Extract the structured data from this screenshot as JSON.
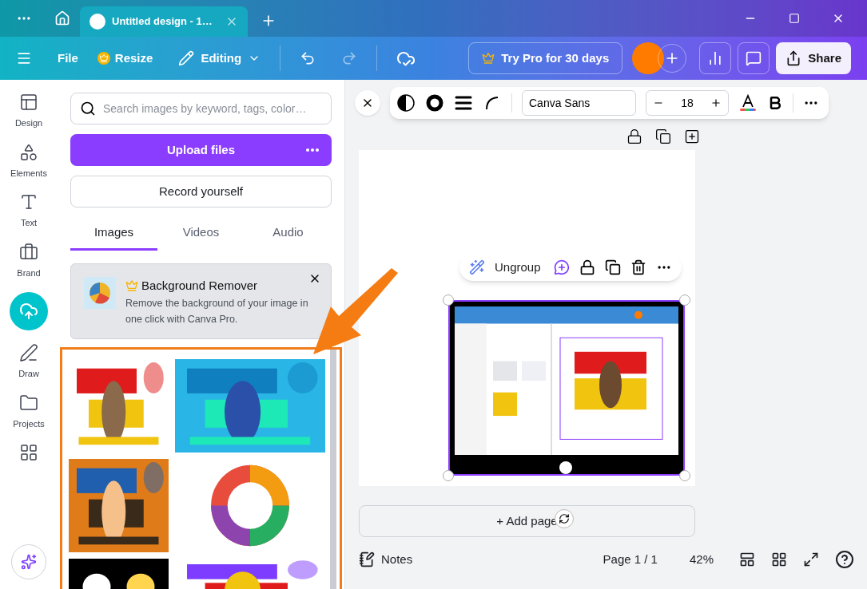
{
  "browser_tabs": [
    {
      "label": "Untitled design - 1…",
      "selected": true
    }
  ],
  "toolbar": {
    "file": "File",
    "resize": "Resize",
    "mode": "Editing",
    "pro": "Try Pro for 30 days",
    "share": "Share"
  },
  "sidebar": {
    "items": [
      {
        "kind": "design",
        "label": "Design",
        "selected": false
      },
      {
        "kind": "elements",
        "label": "Elements",
        "selected": false
      },
      {
        "kind": "text",
        "label": "Text",
        "selected": false
      },
      {
        "kind": "brand",
        "label": "Brand",
        "selected": false
      },
      {
        "kind": "uploads",
        "selected": true
      },
      {
        "kind": "draw",
        "label": "Draw",
        "selected": false
      },
      {
        "kind": "projects",
        "label": "Projects",
        "selected": false
      },
      {
        "kind": "apps",
        "selected": false
      }
    ]
  },
  "panel": {
    "search": {
      "placeholder": "Search images by keyword, tags, color…"
    },
    "upload": "Upload files",
    "record": "Record yourself",
    "tabs": [
      {
        "label": "Images",
        "selected": true
      },
      {
        "label": "Videos",
        "selected": false
      },
      {
        "label": "Audio",
        "selected": false
      }
    ],
    "promo": {
      "title": "Background Remover",
      "text": "Remove the background of your image in one click with Canva Pro."
    }
  },
  "text_toolbar": {
    "font": "Canva Sans",
    "size": "18"
  },
  "element_toolbar": {
    "action": "Ungroup"
  },
  "add_page": "+ Add page",
  "footer": {
    "notes": "Notes",
    "page": "Page 1 / 1",
    "zoom": "42%"
  }
}
